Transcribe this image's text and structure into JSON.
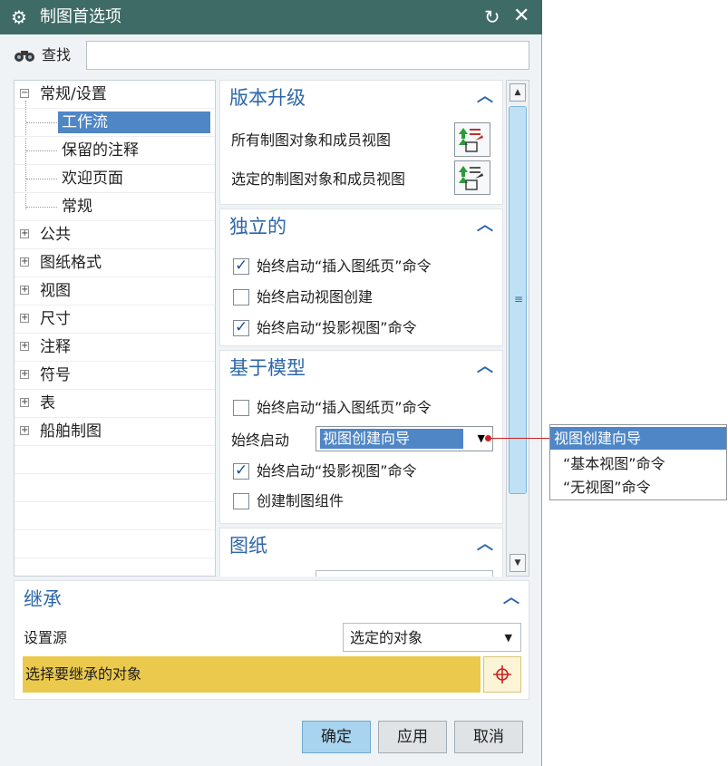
{
  "window": {
    "title": "制图首选项",
    "icons": [
      "gear-icon",
      "reset-icon",
      "close-icon"
    ]
  },
  "search": {
    "label": "查找",
    "value": "",
    "placeholder": ""
  },
  "tree": {
    "items": [
      {
        "label": "常规/设置",
        "expander": "−",
        "selected": false
      },
      {
        "label": "工作流",
        "selected": true
      },
      {
        "label": "保留的注释",
        "selected": false
      },
      {
        "label": "欢迎页面",
        "selected": false
      },
      {
        "label": "常规",
        "selected": false
      },
      {
        "label": "公共",
        "expander": "+"
      },
      {
        "label": "图纸格式",
        "expander": "+"
      },
      {
        "label": "视图",
        "expander": "+"
      },
      {
        "label": "尺寸",
        "expander": "+"
      },
      {
        "label": "注释",
        "expander": "+"
      },
      {
        "label": "符号",
        "expander": "+"
      },
      {
        "label": "表",
        "expander": "+"
      },
      {
        "label": "船舶制图",
        "expander": "+"
      }
    ]
  },
  "sections": {
    "upgrade": {
      "title": "版本升级",
      "rows": [
        {
          "label": "所有制图对象和成员视图",
          "icon": "upgrade-objects-icon"
        },
        {
          "label": "选定的制图对象和成员视图",
          "icon": "upgrade-selected-icon"
        }
      ]
    },
    "standalone": {
      "title": "独立的",
      "checks": [
        {
          "label": "始终启动“插入图纸页”命令",
          "checked": true
        },
        {
          "label": "始终启动视图创建",
          "checked": false
        },
        {
          "label": "始终启动“投影视图”命令",
          "checked": true
        }
      ]
    },
    "model_based": {
      "title": "基于模型",
      "check1": {
        "label": "始终启动“插入图纸页”命令",
        "checked": false
      },
      "start_label": "始终启动",
      "start_value": "视图创建向导",
      "check2": {
        "label": "始终启动“投影视图”命令",
        "checked": true
      },
      "check3": {
        "label": "创建制图组件",
        "checked": false
      }
    },
    "drawing": {
      "title": "图纸"
    }
  },
  "dropdown_options": [
    "视图创建向导",
    "“基本视图”命令",
    "“无视图”命令"
  ],
  "inherit": {
    "title": "继承",
    "source_label": "设置源",
    "source_value": "选定的对象",
    "select_prompt": "选择要继承的对象"
  },
  "buttons": {
    "ok": "确定",
    "apply": "应用",
    "cancel": "取消"
  },
  "colors": {
    "titlebar": "#3e6b66",
    "selection": "#4f86c6",
    "section_title": "#2d67a9",
    "select_bar": "#ebc94c",
    "accent_line": "#cc2222"
  }
}
